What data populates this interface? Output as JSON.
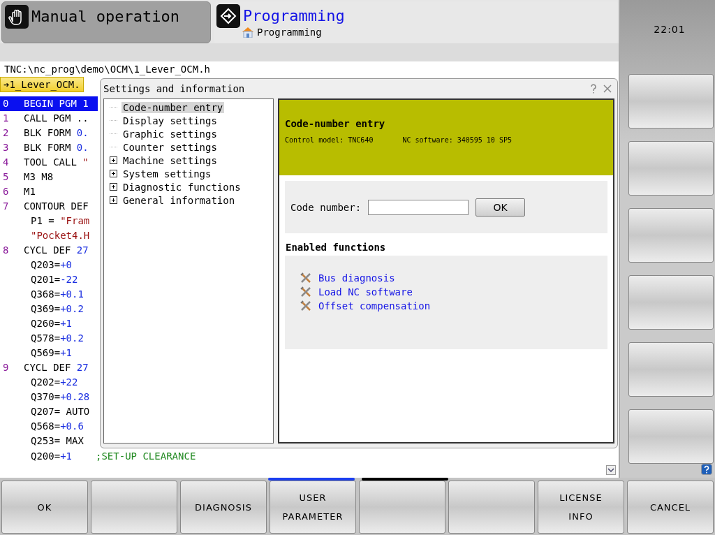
{
  "modes": [
    {
      "kind": "manual",
      "label": "Manual operation",
      "selected": false
    },
    {
      "kind": "programming",
      "label": "Programming",
      "subtitle": "Programming",
      "selected": true
    }
  ],
  "clock": "22:01",
  "path": "TNC:\\nc_prog\\demo\\OCM\\1_Lever_OCM.h",
  "file_tab": {
    "arrow": "➔",
    "label": "1_Lever_OCM."
  },
  "program": [
    {
      "number": "0",
      "parts": [
        {
          "kind": "plain",
          "text": "BEGIN PGM 1"
        }
      ],
      "selected": true
    },
    {
      "number": "1",
      "parts": [
        {
          "kind": "plain",
          "text": "CALL PGM .."
        }
      ],
      "selected": false
    },
    {
      "number": "2",
      "parts": [
        {
          "kind": "plain",
          "text": "BLK FORM "
        },
        {
          "kind": "value",
          "text": "0."
        }
      ],
      "selected": false
    },
    {
      "number": "3",
      "parts": [
        {
          "kind": "plain",
          "text": "BLK FORM "
        },
        {
          "kind": "value",
          "text": "0."
        }
      ],
      "selected": false
    },
    {
      "number": "4",
      "parts": [
        {
          "kind": "plain",
          "text": "TOOL CALL "
        },
        {
          "kind": "string",
          "text": "\""
        }
      ],
      "selected": false
    },
    {
      "number": "5",
      "parts": [
        {
          "kind": "plain",
          "text": "M3 M8"
        }
      ],
      "selected": false
    },
    {
      "number": "6",
      "parts": [
        {
          "kind": "plain",
          "text": "M1"
        }
      ],
      "selected": false
    },
    {
      "number": "7",
      "parts": [
        {
          "kind": "plain",
          "text": "CONTOUR DEF"
        }
      ],
      "selected": false
    },
    {
      "parts": [
        {
          "kind": "plain",
          "text": "P1 = "
        },
        {
          "kind": "string",
          "text": "\"Fram"
        }
      ],
      "selected": false
    },
    {
      "parts": [
        {
          "kind": "string",
          "text": "\"Pocket4.H"
        }
      ],
      "selected": false
    },
    {
      "number": "8",
      "parts": [
        {
          "kind": "plain",
          "text": "CYCL DEF "
        },
        {
          "kind": "value",
          "text": "27"
        }
      ],
      "selected": false
    },
    {
      "parts": [
        {
          "kind": "plain",
          "text": "Q203="
        },
        {
          "kind": "value",
          "text": "+0"
        }
      ],
      "selected": false
    },
    {
      "parts": [
        {
          "kind": "plain",
          "text": "Q201="
        },
        {
          "kind": "value",
          "text": "-22"
        }
      ],
      "selected": false
    },
    {
      "parts": [
        {
          "kind": "plain",
          "text": "Q368="
        },
        {
          "kind": "value",
          "text": "+0.1"
        }
      ],
      "selected": false
    },
    {
      "parts": [
        {
          "kind": "plain",
          "text": "Q369="
        },
        {
          "kind": "value",
          "text": "+0.2"
        }
      ],
      "selected": false
    },
    {
      "parts": [
        {
          "kind": "plain",
          "text": "Q260="
        },
        {
          "kind": "value",
          "text": "+1"
        }
      ],
      "selected": false
    },
    {
      "parts": [
        {
          "kind": "plain",
          "text": "Q578="
        },
        {
          "kind": "value",
          "text": "+0.2"
        }
      ],
      "selected": false
    },
    {
      "parts": [
        {
          "kind": "plain",
          "text": "Q569="
        },
        {
          "kind": "value",
          "text": "+1"
        }
      ],
      "selected": false
    },
    {
      "number": "9",
      "parts": [
        {
          "kind": "plain",
          "text": "CYCL DEF "
        },
        {
          "kind": "value",
          "text": "27"
        }
      ],
      "selected": false
    },
    {
      "parts": [
        {
          "kind": "plain",
          "text": "Q202="
        },
        {
          "kind": "value",
          "text": "+22"
        }
      ],
      "selected": false
    },
    {
      "parts": [
        {
          "kind": "plain",
          "text": "Q370="
        },
        {
          "kind": "value",
          "text": "+0.28"
        }
      ],
      "selected": false
    },
    {
      "parts": [
        {
          "kind": "plain",
          "text": "Q207= AUTO"
        }
      ],
      "selected": false
    },
    {
      "parts": [
        {
          "kind": "plain",
          "text": "Q568="
        },
        {
          "kind": "value",
          "text": "+0.6"
        }
      ],
      "selected": false
    },
    {
      "parts": [
        {
          "kind": "plain",
          "text": "Q253= MAX"
        }
      ],
      "selected": false
    },
    {
      "parts": [
        {
          "kind": "plain",
          "text": "Q200="
        },
        {
          "kind": "value",
          "text": "+1"
        },
        {
          "kind": "comment",
          "text": ";SET-UP CLEARANCE"
        }
      ],
      "selected": false
    }
  ],
  "dialog": {
    "title": "Settings and information",
    "tree": [
      {
        "kind": "leaf",
        "label": "Code-number entry",
        "selected": true
      },
      {
        "kind": "leaf",
        "label": "Display settings",
        "selected": false
      },
      {
        "kind": "leaf",
        "label": "Graphic settings",
        "selected": false
      },
      {
        "kind": "leaf",
        "label": "Counter settings",
        "selected": false
      },
      {
        "kind": "branch",
        "label": "Machine settings",
        "expanded": false,
        "selected": false
      },
      {
        "kind": "branch",
        "label": "System settings",
        "expanded": false,
        "selected": false
      },
      {
        "kind": "branch",
        "label": "Diagnostic functions",
        "expanded": false,
        "selected": false
      },
      {
        "kind": "branch",
        "label": "General information",
        "expanded": false,
        "selected": false
      }
    ],
    "heading": "Code-number entry",
    "info": [
      "Control model: TNC640",
      "NC software: 340595 10 SP5"
    ],
    "code_label": "Code number:",
    "ok_button": "OK",
    "functions_title": "Enabled functions",
    "functions": [
      "Bus diagnosis",
      "Load NC software",
      "Offset compensation"
    ]
  },
  "softkey_pages": [
    {
      "selected": true
    },
    {
      "selected": false
    }
  ],
  "softkeys": [
    {
      "kind": "text",
      "lines": [
        "OK"
      ]
    },
    {
      "kind": "empty"
    },
    {
      "kind": "text",
      "lines": [
        "DIAGNOSIS"
      ]
    },
    {
      "kind": "text",
      "lines": [
        "USER",
        "PARAMETER"
      ]
    },
    {
      "kind": "empty"
    },
    {
      "kind": "empty"
    },
    {
      "kind": "text",
      "lines": [
        "LICENSE",
        "INFO"
      ]
    },
    {
      "kind": "text",
      "lines": [
        "CANCEL"
      ]
    }
  ],
  "side_softkeys": [
    {
      "kind": "empty"
    },
    {
      "kind": "empty"
    },
    {
      "kind": "empty"
    },
    {
      "kind": "empty"
    },
    {
      "kind": "empty"
    },
    {
      "kind": "empty"
    }
  ]
}
